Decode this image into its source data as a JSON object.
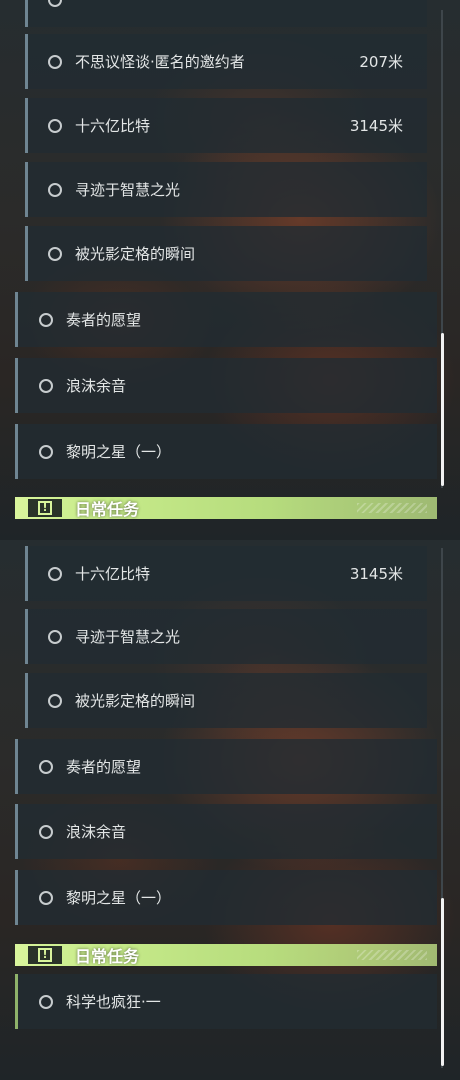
{
  "top_panel": {
    "rows": [
      {
        "label": "不思议怪谈·匿名的邀约者",
        "distance": "207米"
      },
      {
        "label": "十六亿比特",
        "distance": "3145米"
      },
      {
        "label": "寻迹于智慧之光",
        "distance": ""
      },
      {
        "label": "被光影定格的瞬间",
        "distance": ""
      },
      {
        "label": "奏者的愿望",
        "distance": ""
      },
      {
        "label": "浪沫余音",
        "distance": ""
      },
      {
        "label": "黎明之星（一）",
        "distance": ""
      }
    ],
    "section_title": "日常任务"
  },
  "bottom_panel": {
    "rows": [
      {
        "label": "十六亿比特",
        "distance": "3145米"
      },
      {
        "label": "寻迹于智慧之光",
        "distance": ""
      },
      {
        "label": "被光影定格的瞬间",
        "distance": ""
      },
      {
        "label": "奏者的愿望",
        "distance": ""
      },
      {
        "label": "浪沫余音",
        "distance": ""
      },
      {
        "label": "黎明之星（一）",
        "distance": ""
      }
    ],
    "section_title": "日常任务",
    "daily_rows": [
      {
        "label": "科学也疯狂·一"
      }
    ]
  },
  "colors": {
    "accent_green": "#d9f59c",
    "row_border": "#6f8592",
    "daily_border": "#8fb26a"
  },
  "icons": {
    "quest_status": "circle-outline-icon",
    "section": "alert-icon"
  }
}
